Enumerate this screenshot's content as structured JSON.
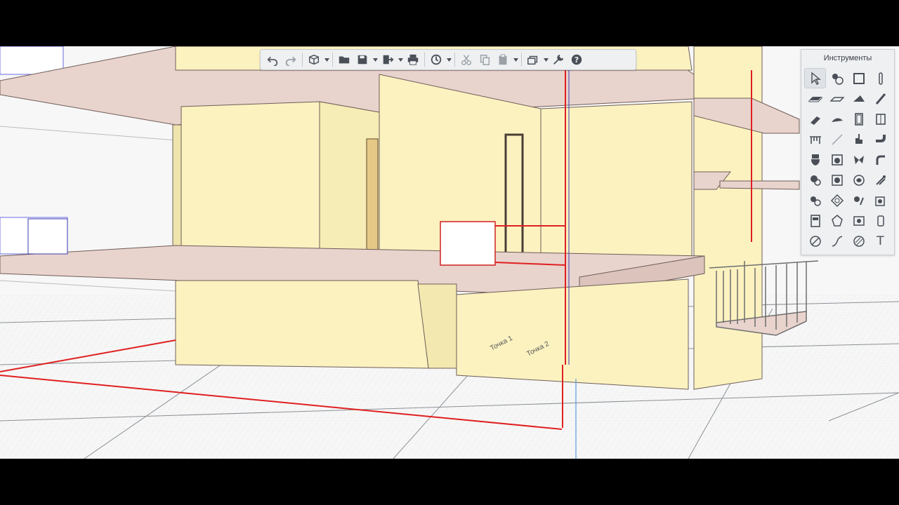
{
  "palette": {
    "title": "Инструменты",
    "tools": [
      {
        "icon": "select-arrow-icon",
        "active": true
      },
      {
        "icon": "annotation-icon"
      },
      {
        "icon": "wall-rect-icon"
      },
      {
        "icon": "column-icon"
      },
      {
        "icon": "slab-icon"
      },
      {
        "icon": "floor-slab-icon"
      },
      {
        "icon": "roof-icon"
      },
      {
        "icon": "beam-icon"
      },
      {
        "icon": "stair-icon"
      },
      {
        "icon": "ramp-icon"
      },
      {
        "icon": "door-icon"
      },
      {
        "icon": "window-icon"
      },
      {
        "icon": "table-icon"
      },
      {
        "icon": "line-icon"
      },
      {
        "icon": "faucet-icon"
      },
      {
        "icon": "pipe-bend-icon"
      },
      {
        "icon": "toilet-icon"
      },
      {
        "icon": "washer-icon"
      },
      {
        "icon": "fan-icon"
      },
      {
        "icon": "pipe-fitting-icon"
      },
      {
        "icon": "fire-icon"
      },
      {
        "icon": "valve-icon"
      },
      {
        "icon": "sprinkler-icon"
      },
      {
        "icon": "pump-icon"
      },
      {
        "icon": "duct-icon"
      },
      {
        "icon": "lamp-icon"
      },
      {
        "icon": "cable-icon"
      },
      {
        "icon": "socket-icon"
      },
      {
        "icon": "panel-icon"
      },
      {
        "icon": "device-icon"
      },
      {
        "icon": "sensor-icon"
      },
      {
        "icon": "switch-icon"
      },
      {
        "icon": "dimension-icon"
      },
      {
        "icon": "polyline-icon"
      },
      {
        "icon": "hatch-icon"
      },
      {
        "icon": "text-icon",
        "glyph": "T"
      }
    ]
  },
  "toolbar": {
    "buttons": [
      "undo-icon",
      "redo-icon",
      "view-3d-icon",
      "open-folder-icon",
      "save-icon",
      "export-icon",
      "print-icon",
      "sync-icon",
      "cut-icon",
      "copy-icon",
      "paste-icon",
      "layers-icon",
      "settings-wrench-icon",
      "help-icon"
    ]
  },
  "scene": {
    "labels": [
      "Точка 1",
      "Точка 2"
    ],
    "colors": {
      "wall": "#fbf2c0",
      "slab": "#e9d3cd",
      "pipe": "#e02020",
      "grid": "#d9dcdf",
      "background": "#f7f7f7"
    }
  }
}
